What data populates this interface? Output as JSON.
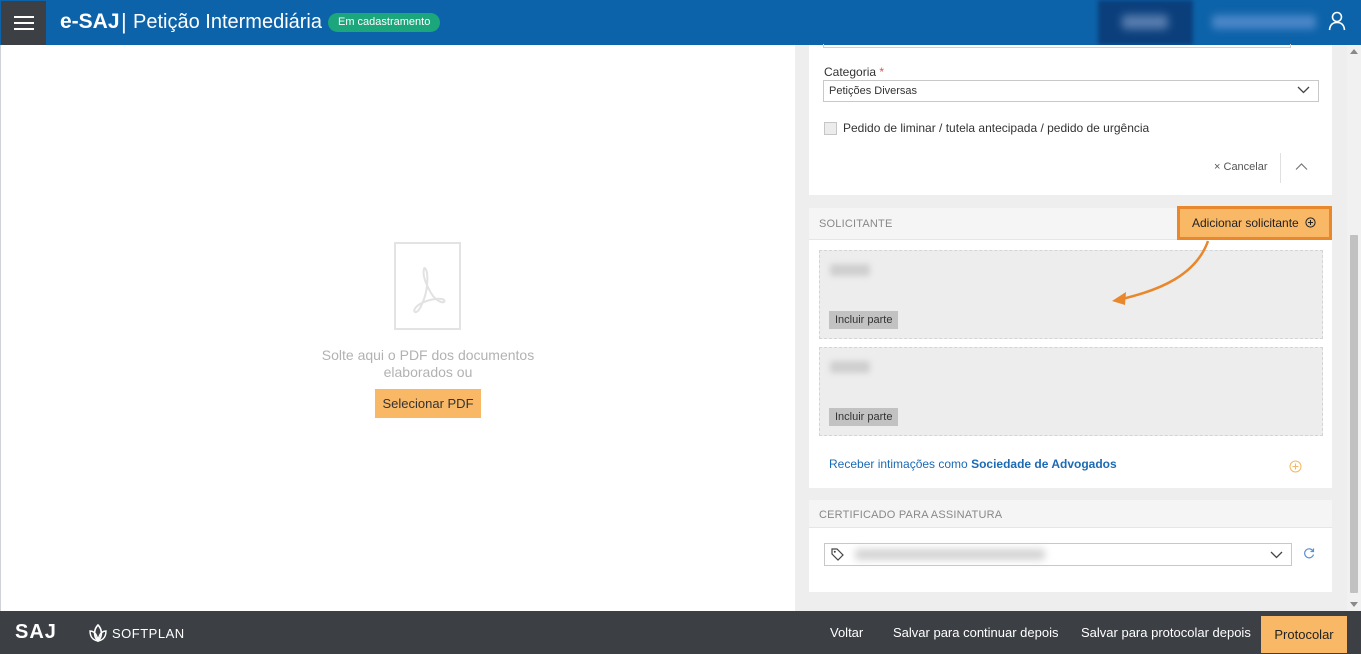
{
  "header": {
    "brand": "e-SAJ",
    "separator": "|",
    "title": "Petição Intermediária",
    "status_badge": "Em cadastramento",
    "icons": [
      "menu-icon",
      "user-icon"
    ]
  },
  "left": {
    "drop_text": "Solte aqui o PDF dos documentos elaborados ou",
    "select_pdf_label": "Selecionar PDF",
    "icon": "pdf-icon"
  },
  "form": {
    "categoria_label": "Categoria",
    "required_marker": "*",
    "categoria_value": "Petições Diversas",
    "liminar_label": "Pedido de liminar / tutela antecipada / pedido de urgência",
    "liminar_checked": false,
    "cancel_label": "Cancelar",
    "cancel_icon": "×"
  },
  "solicitante": {
    "section_title": "SOLICITANTE",
    "add_label": "Adicionar solicitante",
    "parties": [
      {
        "include_label": "Incluir parte"
      },
      {
        "include_label": "Incluir parte"
      }
    ],
    "receber_prefix": "Receber intimações como",
    "receber_bold": "Sociedade de Advogados"
  },
  "certificado": {
    "section_title": "CERTIFICADO PARA ASSINATURA"
  },
  "footer": {
    "saj_logo": "SAJ",
    "softplan": "SOFTPLAN",
    "voltar": "Voltar",
    "salvar_continuar": "Salvar para continuar depois",
    "salvar_protocolar": "Salvar para protocolar depois",
    "protocolar": "Protocolar"
  },
  "colors": {
    "header_blue": "#0d63a9",
    "accent_orange": "#f9b866",
    "highlight_orange": "#e8872b",
    "status_green": "#1ba67b",
    "footer_dark": "#3c3f44",
    "link_blue": "#1b6ab5"
  }
}
